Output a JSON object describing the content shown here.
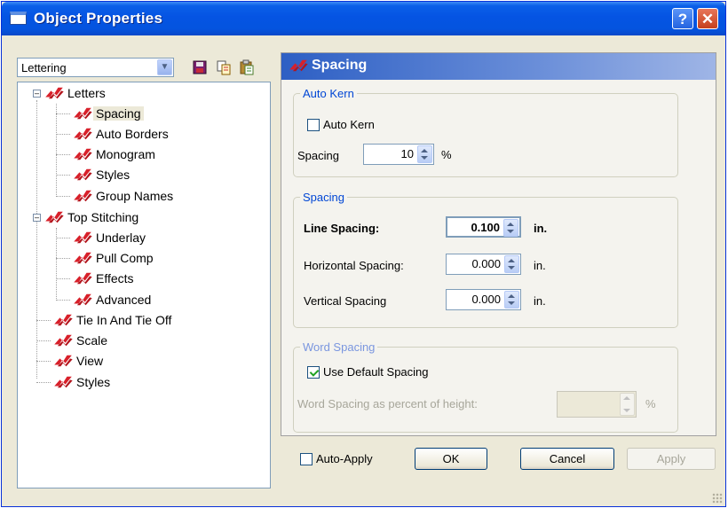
{
  "window": {
    "title": "Object Properties",
    "help_label": "?",
    "close_label": "✕"
  },
  "left": {
    "combo_value": "Lettering",
    "tree": [
      {
        "label": "Letters"
      },
      {
        "label": "Spacing"
      },
      {
        "label": "Auto Borders"
      },
      {
        "label": "Monogram"
      },
      {
        "label": "Styles"
      },
      {
        "label": "Group Names"
      },
      {
        "label": "Top Stitching"
      },
      {
        "label": "Underlay"
      },
      {
        "label": "Pull Comp"
      },
      {
        "label": "Effects"
      },
      {
        "label": "Advanced"
      },
      {
        "label": "Tie In And Tie Off"
      },
      {
        "label": "Scale"
      },
      {
        "label": "View"
      },
      {
        "label": "Styles"
      }
    ]
  },
  "panel": {
    "title": "Spacing",
    "auto_kern": {
      "legend": "Auto Kern",
      "checkbox_label": "Auto Kern",
      "checked": false,
      "spacing_label": "Spacing",
      "spacing_value": "10",
      "spacing_unit": "%"
    },
    "spacing": {
      "legend": "Spacing",
      "line_label": "Line Spacing:",
      "line_value": "0.100",
      "line_unit": "in.",
      "horizontal_label": "Horizontal Spacing:",
      "horizontal_value": "0.000",
      "horizontal_unit": "in.",
      "vertical_label": "Vertical Spacing",
      "vertical_value": "0.000",
      "vertical_unit": "in."
    },
    "word_spacing": {
      "legend": "Word Spacing",
      "checkbox_label": "Use Default Spacing",
      "checked": true,
      "percent_label": "Word Spacing as percent of height:",
      "percent_value": "",
      "percent_unit": "%"
    }
  },
  "footer": {
    "auto_apply_label": "Auto-Apply",
    "auto_apply_checked": false,
    "ok_label": "OK",
    "cancel_label": "Cancel",
    "apply_label": "Apply"
  },
  "colors": {
    "accent": "#0554e3",
    "bolt": "#d8202a",
    "legend": "#0046d5"
  }
}
